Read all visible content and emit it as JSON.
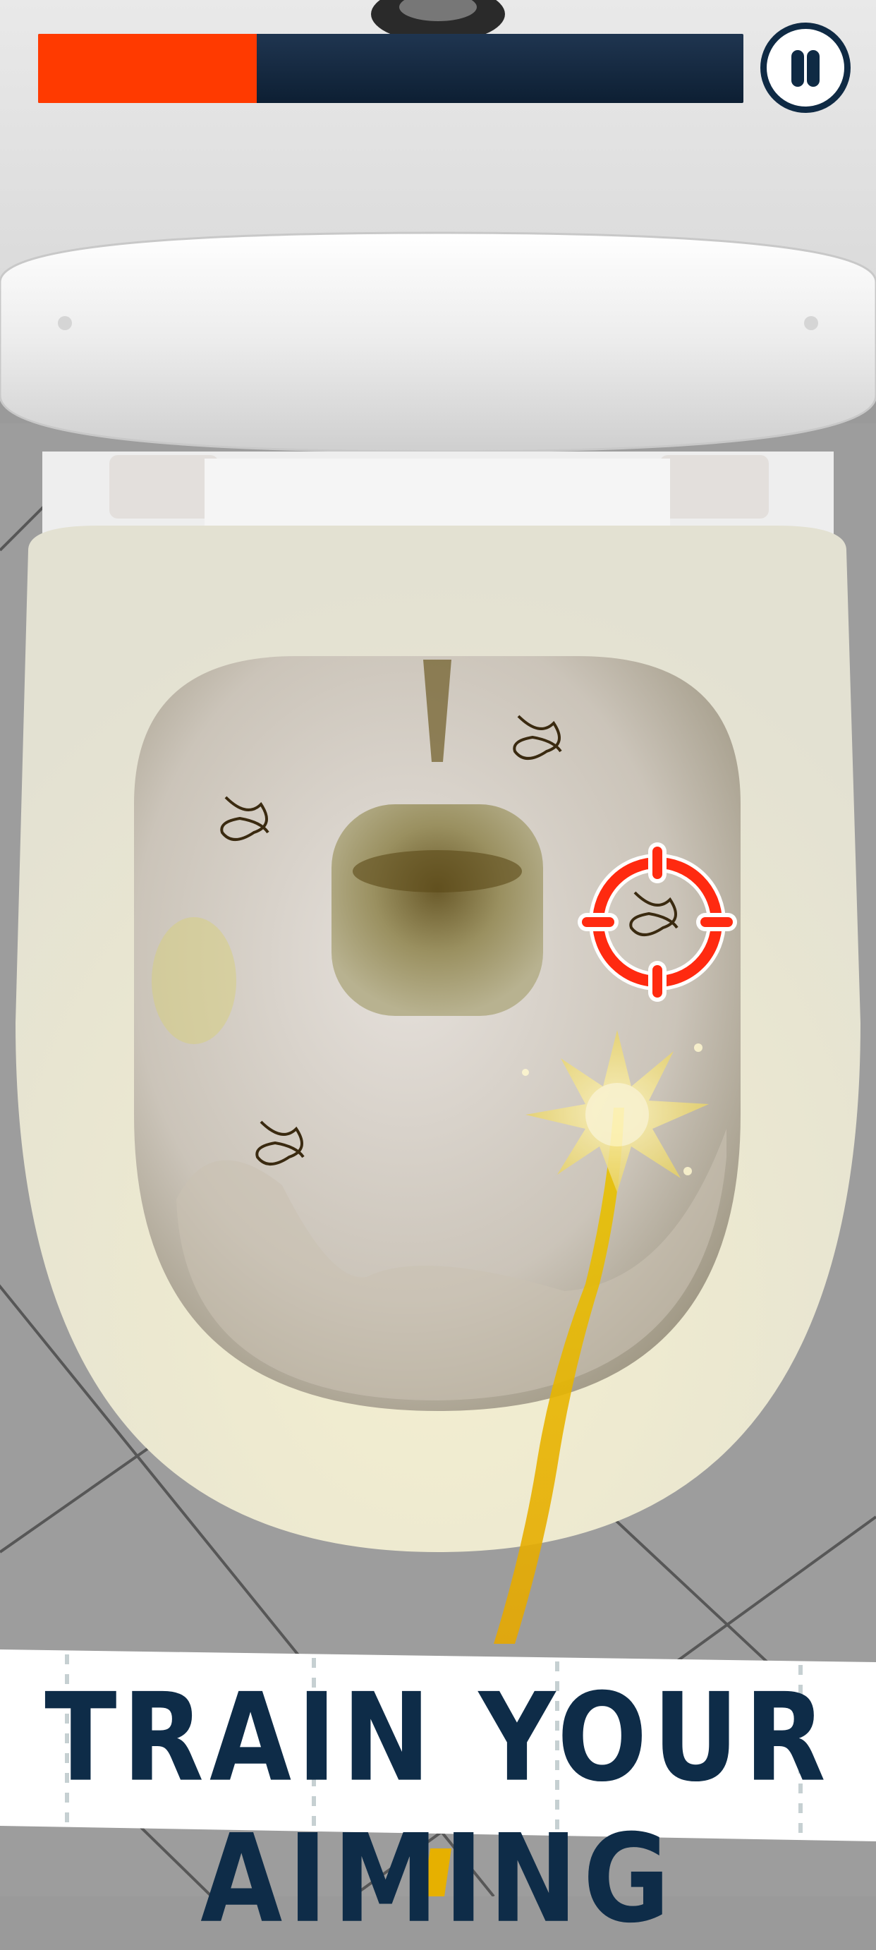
{
  "hud": {
    "progress_fraction": 0.31,
    "progress_color": "#ff3a00",
    "track_color": "#10263d"
  },
  "pause_button": {
    "icon": "pause-icon"
  },
  "banner": {
    "text": "TRAIN YOUR AIMING"
  },
  "targets": [
    {
      "icon": "germ-icon"
    },
    {
      "icon": "germ-icon"
    },
    {
      "icon": "germ-icon"
    },
    {
      "icon": "germ-icon"
    }
  ],
  "crosshair": {
    "icon": "crosshair-icon",
    "color": "#ff2a10"
  },
  "stream": {
    "color": "#f2c200"
  }
}
